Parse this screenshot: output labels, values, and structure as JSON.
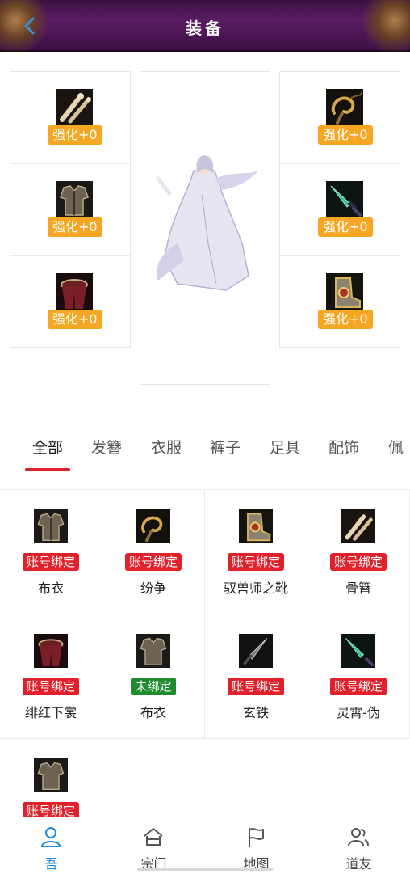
{
  "header": {
    "title": "装备"
  },
  "equipment": {
    "left_slots": [
      {
        "icon": "bone-hairpin-icon",
        "level": "强化+0"
      },
      {
        "icon": "armor-robe-icon",
        "level": "强化+0"
      },
      {
        "icon": "red-pants-icon",
        "level": "强化+0"
      }
    ],
    "right_slots": [
      {
        "icon": "whip-icon",
        "level": "强化+0"
      },
      {
        "icon": "jade-sword-icon",
        "level": "强化+0"
      },
      {
        "icon": "boots-icon",
        "level": "强化+0"
      }
    ],
    "level_color": "#f5a623"
  },
  "tabs": [
    "全部",
    "发簪",
    "衣服",
    "裤子",
    "足具",
    "配饰",
    "佩"
  ],
  "active_tab": 0,
  "items": [
    {
      "icon": "armor-robe-icon",
      "bind": "账号绑定",
      "name": "布衣"
    },
    {
      "icon": "whip-icon",
      "bind": "账号绑定",
      "name": "纷争"
    },
    {
      "icon": "boots-icon",
      "bind": "账号绑定",
      "name": "驭兽师之靴"
    },
    {
      "icon": "bone-hairpin-icon",
      "bind": "账号绑定",
      "name": "骨簪"
    },
    {
      "icon": "red-pants-icon",
      "bind": "账号绑定",
      "name": "绯红下裳"
    },
    {
      "icon": "armor-robe-icon",
      "bind": "未绑定",
      "name": "布衣"
    },
    {
      "icon": "iron-blade-icon",
      "bind": "账号绑定",
      "name": "玄铁"
    },
    {
      "icon": "jade-sword-icon",
      "bind": "账号绑定",
      "name": "灵霄-伪"
    },
    {
      "icon": "armor-robe-icon",
      "bind": "账号绑定",
      "name": ""
    }
  ],
  "colors": {
    "account_bound": "#e0202a",
    "unbound": "#1f8a2e",
    "accent": "#1e88e5"
  },
  "nav": [
    {
      "icon": "user-icon",
      "label": "吾"
    },
    {
      "icon": "sect-house-icon",
      "label": "宗门"
    },
    {
      "icon": "map-flag-icon",
      "label": "地图"
    },
    {
      "icon": "friends-icon",
      "label": "道友"
    }
  ],
  "active_nav": 0
}
